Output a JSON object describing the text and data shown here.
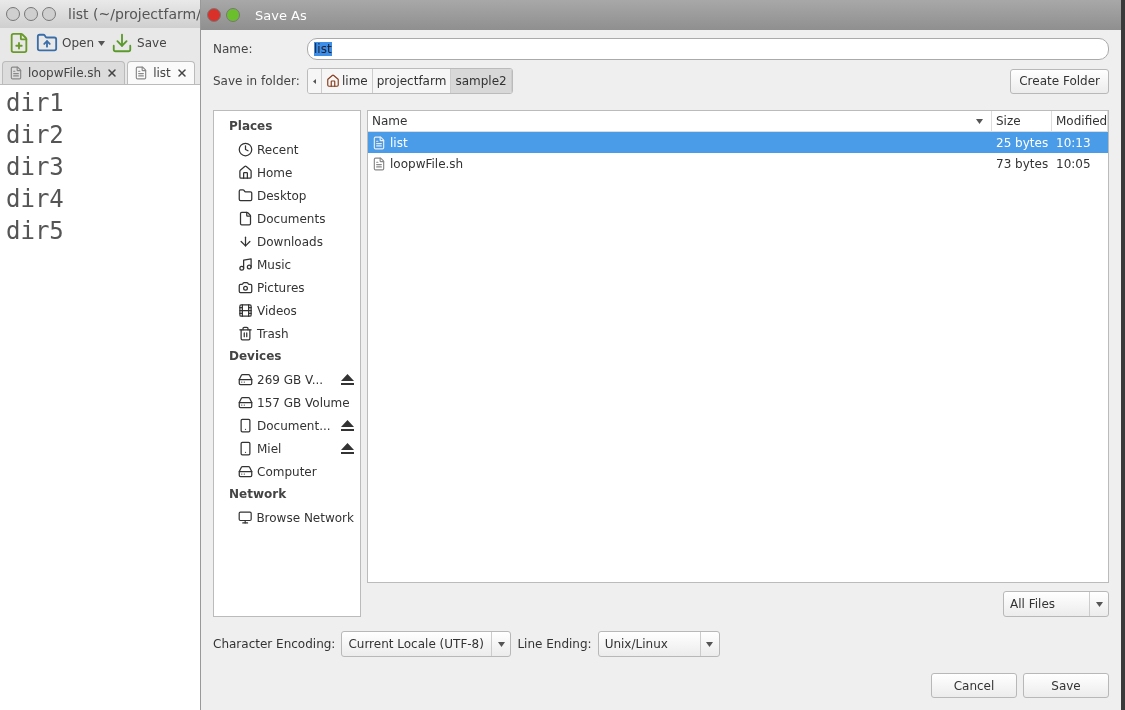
{
  "editor": {
    "title": "list (~/projectfarm/",
    "toolbar": [
      {
        "kind": "new"
      },
      {
        "kind": "open",
        "label": "Open"
      },
      {
        "kind": "save",
        "label": "Save"
      }
    ],
    "tabs": [
      {
        "label": "loopwFile.sh",
        "selected": false
      },
      {
        "label": "list",
        "selected": true
      }
    ],
    "lines": [
      "dir1",
      "dir2",
      "dir3",
      "dir4",
      "dir5"
    ]
  },
  "dialog": {
    "title": "Save As",
    "name_label": "Name:",
    "name_value": "list",
    "folder_label": "Save in folder:",
    "path": [
      {
        "label": "lime",
        "kind": "home",
        "selected": false
      },
      {
        "label": "projectfarm",
        "kind": "folder",
        "selected": false
      },
      {
        "label": "sample2",
        "kind": "folder",
        "selected": true
      }
    ],
    "create_folder": "Create Folder",
    "sidebar": [
      {
        "heading": "Places",
        "items": [
          {
            "label": "Recent"
          },
          {
            "label": "Home"
          },
          {
            "label": "Desktop"
          },
          {
            "label": "Documents"
          },
          {
            "label": "Downloads"
          },
          {
            "label": "Music"
          },
          {
            "label": "Pictures"
          },
          {
            "label": "Videos"
          },
          {
            "label": "Trash"
          }
        ]
      },
      {
        "heading": "Devices",
        "items": [
          {
            "label": "269 GB V...",
            "eject": true
          },
          {
            "label": "157 GB Volume",
            "eject": false
          },
          {
            "label": "Document...",
            "eject": true
          },
          {
            "label": "Miel",
            "eject": true
          },
          {
            "label": "Computer",
            "eject": false
          }
        ]
      },
      {
        "heading": "Network",
        "items": [
          {
            "label": "Browse Network"
          }
        ]
      }
    ],
    "columns": [
      "Name",
      "Size",
      "Modified"
    ],
    "rows": [
      {
        "name": "list",
        "size": "25 bytes",
        "modified": "10:13",
        "selected": true
      },
      {
        "name": "loopwFile.sh",
        "size": "73 bytes",
        "modified": "10:05",
        "selected": false
      }
    ],
    "filter": "All Files",
    "encoding_label": "Character Encoding:",
    "encoding": "Current Locale (UTF-8)",
    "line_ending_label": "Line Ending:",
    "line_ending": "Unix/Linux",
    "buttons": [
      "Cancel",
      "Save"
    ]
  }
}
